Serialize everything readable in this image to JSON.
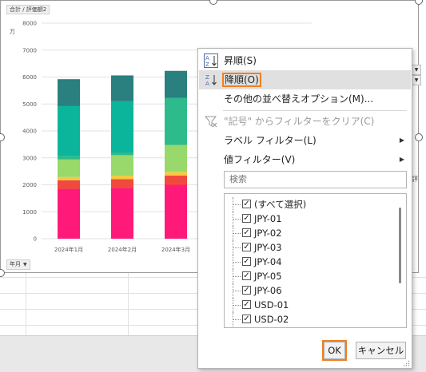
{
  "chart": {
    "field_button_top": "合計 / 評価額2",
    "unit_label": "万",
    "field_button_bottom": "年月",
    "dropdown_glyph": "▼"
  },
  "chart_data": {
    "type": "bar",
    "stacked": true,
    "categories": [
      "2024年1月",
      "2024年2月",
      "2024年3月"
    ],
    "ylim": [
      0,
      8000
    ],
    "yticks": [
      "0",
      "1000",
      "2000",
      "3000",
      "4000",
      "5000",
      "6000",
      "7000",
      "8000"
    ],
    "series": [
      {
        "color": "#ff1a7a",
        "values": [
          1850,
          1880,
          2000
        ]
      },
      {
        "color": "#f04a3c",
        "values": [
          320,
          330,
          340
        ]
      },
      {
        "color": "#f7c843",
        "values": [
          120,
          130,
          140
        ]
      },
      {
        "color": "#99d86a",
        "values": [
          650,
          760,
          1000
        ]
      },
      {
        "color": "#2dbb8c",
        "values": [
          130,
          100,
          1750
        ]
      },
      {
        "color": "#0bb59b",
        "values": [
          1850,
          1900,
          0
        ]
      },
      {
        "color": "#2a7f7f",
        "values": [
          1000,
          960,
          1000
        ]
      }
    ]
  },
  "menu": {
    "sort_asc": "昇順(S)",
    "sort_desc": "降順(O)",
    "sort_other": "その他の並べ替えオプション(M)...",
    "clear_filter": "\"記号\" からフィルターをクリア(C)",
    "label_filter": "ラベル フィルター(L)",
    "value_filter": "値フィルター(V)",
    "search_placeholder": "検索",
    "items": [
      {
        "label": "(すべて選択)",
        "checked": true
      },
      {
        "label": "JPY-01",
        "checked": true
      },
      {
        "label": "JPY-02",
        "checked": true
      },
      {
        "label": "JPY-03",
        "checked": true
      },
      {
        "label": "JPY-04",
        "checked": true
      },
      {
        "label": "JPY-05",
        "checked": true
      },
      {
        "label": "JPY-06",
        "checked": true
      },
      {
        "label": "USD-01",
        "checked": true
      },
      {
        "label": "USD-02",
        "checked": true
      }
    ],
    "ok": "OK",
    "cancel": "キャンセル",
    "submenu_glyph": "▶",
    "check_glyph": "✓"
  },
  "peek": {
    "right_label": "評"
  }
}
